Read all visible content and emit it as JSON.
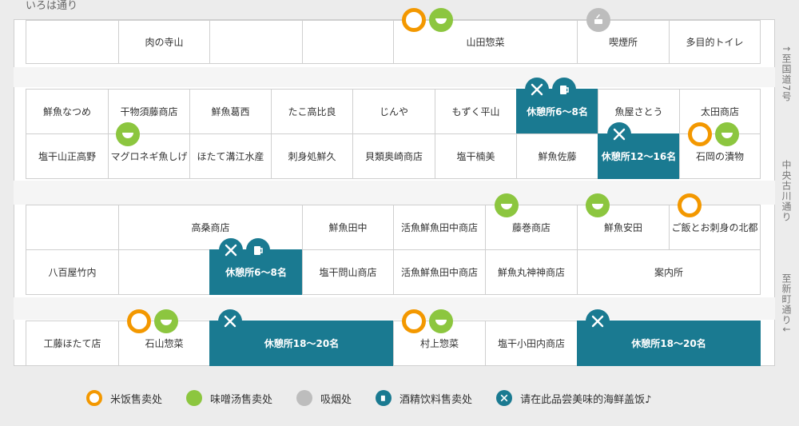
{
  "streets": {
    "top": "いろは通り",
    "right_1": "↑至国道7号",
    "right_2": "中央古川通り",
    "right_3": "至新町通り↓"
  },
  "block1": {
    "row1": [
      "",
      "肉の寺山",
      "",
      "",
      "山田惣菜",
      "",
      "喫煙所",
      "多目的トイレ"
    ]
  },
  "block2": {
    "row1": [
      "鮮魚なつめ",
      "干物須藤商店",
      "鮮魚葛西",
      "たこ高比良",
      "じんや",
      "もずく平山",
      "休憩所6〜8名",
      "魚屋さとう",
      "太田商店"
    ],
    "row2": [
      "塩干山正高野",
      "マグロネギ魚しげ",
      "ほたて溝江水産",
      "刺身処鮮久",
      "貝類奥崎商店",
      "塩干楠美",
      "鮮魚佐藤",
      "休憩所12〜16名",
      "石岡の漬物"
    ]
  },
  "block3": {
    "row1": [
      "",
      "高桑商店",
      "鮮魚田中",
      "活魚鮮魚田中商店",
      "藤巻商店",
      "鮮魚安田",
      "ご飯とお刺身の北都"
    ],
    "row2": [
      "八百屋竹内",
      "",
      "休憩所6〜8名",
      "塩干問山商店",
      "活魚鮮魚田中商店",
      "鮮魚丸神神商店",
      "案内所"
    ]
  },
  "block4": {
    "row1": [
      "工藤ほたて店",
      "石山惣菜",
      "休憩所18〜20名",
      "村上惣菜",
      "塩干小田内商店",
      "休憩所18〜20名"
    ]
  },
  "legend": [
    {
      "icon": "rice-icon",
      "label": "米饭售卖处"
    },
    {
      "icon": "miso-soup-icon",
      "label": "味噌汤售卖处"
    },
    {
      "icon": "smoking-icon",
      "label": "吸烟处"
    },
    {
      "icon": "drink-icon",
      "label": "酒精饮料售卖处"
    },
    {
      "icon": "dish-icon",
      "label": "请在此品尝美味的海鲜盖饭♪"
    }
  ],
  "colors": {
    "rice": "#f39800",
    "miso": "#8cc63f",
    "smoking": "#bdbdbd",
    "rest": "#1a7a91"
  }
}
